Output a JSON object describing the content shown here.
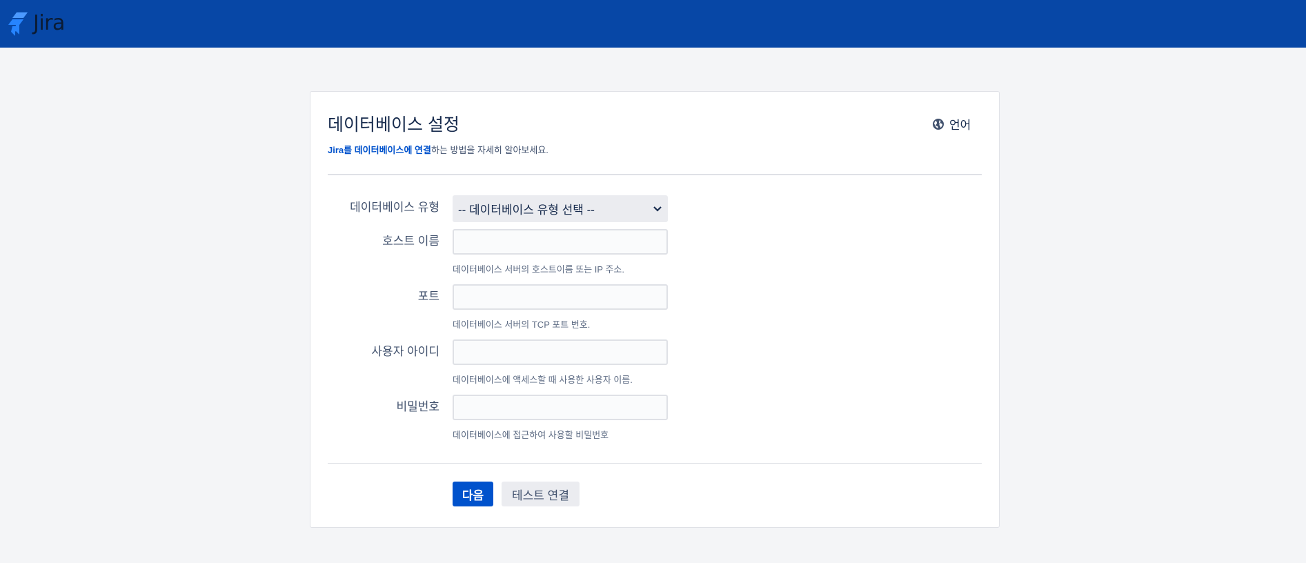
{
  "header": {
    "logo_text": "Jira",
    "brand_color": "#0747a6",
    "logo_icon": "jira-logo-icon"
  },
  "page": {
    "title": "데이터베이스 설정",
    "language_label": "언어",
    "language_icon": "globe-icon",
    "intro_link": "Jira를 데이터베이스에 연결",
    "intro_rest": "하는 방법을 자세히 알아보세요."
  },
  "form": {
    "db_type_label": "데이터베이스 유형",
    "db_type_selected": "-- 데이터베이스 유형 선택 --",
    "host_label": "호스트 이름",
    "host_value": "",
    "host_help": "데이터베이스 서버의 호스트이름 또는 IP 주소.",
    "port_label": "포트",
    "port_value": "",
    "port_help": "데이터베이스 서버의 TCP 포트 번호.",
    "user_label": "사용자 아이디",
    "user_value": "",
    "user_help": "데이터베이스에 액세스할 때 사용한 사용자 이름.",
    "password_label": "비밀번호",
    "password_value": "",
    "password_help": "데이터베이스에 접근하여 사용할 비밀번호"
  },
  "actions": {
    "next_label": "다음",
    "test_label": "테스트 연결",
    "primary_color": "#0052cc"
  }
}
